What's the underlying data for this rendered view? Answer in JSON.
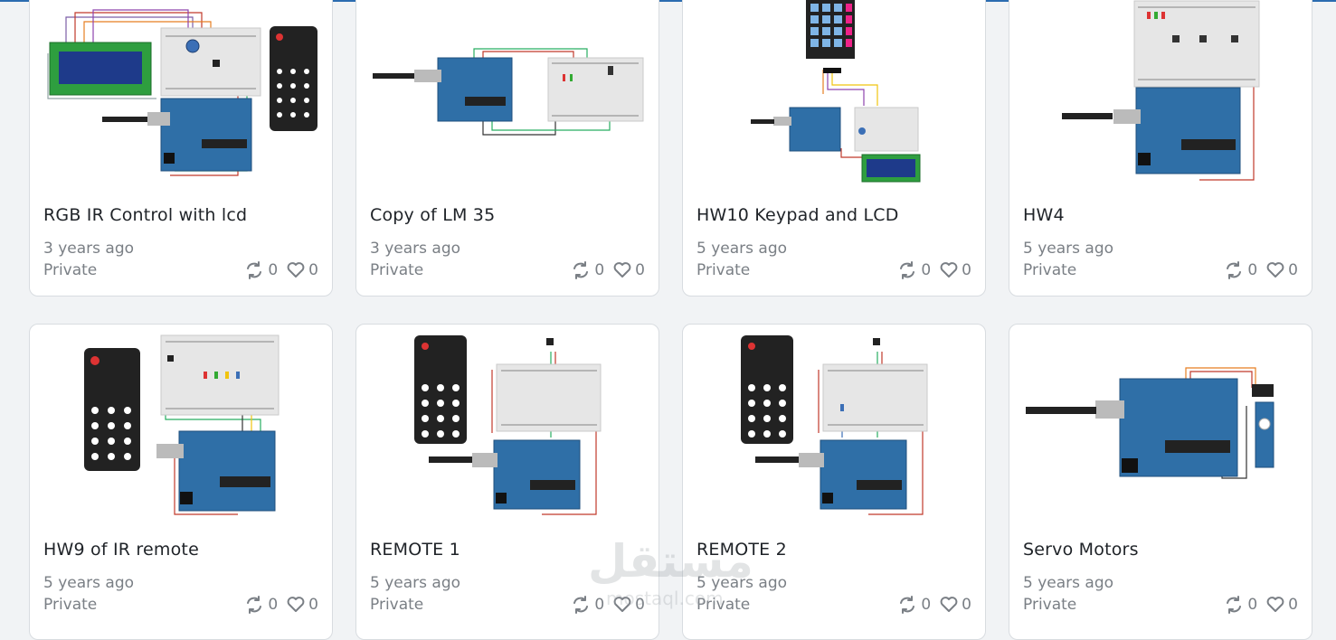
{
  "cards": [
    {
      "title": "RGB IR Control with lcd",
      "age": "3 years ago",
      "visibility": "Private",
      "remixes": "0",
      "likes": "0",
      "circuit": "rgb-ir-lcd"
    },
    {
      "title": "Copy of LM 35",
      "age": "3 years ago",
      "visibility": "Private",
      "remixes": "0",
      "likes": "0",
      "circuit": "lm35"
    },
    {
      "title": "HW10 Keypad and LCD",
      "age": "5 years ago",
      "visibility": "Private",
      "remixes": "0",
      "likes": "0",
      "circuit": "keypad-lcd"
    },
    {
      "title": "HW4",
      "age": "5 years ago",
      "visibility": "Private",
      "remixes": "0",
      "likes": "0",
      "circuit": "hw4"
    },
    {
      "title": "HW9 of IR remote",
      "age": "5 years ago",
      "visibility": "Private",
      "remixes": "0",
      "likes": "0",
      "circuit": "ir-remote-leds"
    },
    {
      "title": "REMOTE 1",
      "age": "5 years ago",
      "visibility": "Private",
      "remixes": "0",
      "likes": "0",
      "circuit": "remote1"
    },
    {
      "title": "REMOTE 2",
      "age": "5 years ago",
      "visibility": "Private",
      "remixes": "0",
      "likes": "0",
      "circuit": "remote2"
    },
    {
      "title": "Servo Motors",
      "age": "5 years ago",
      "visibility": "Private",
      "remixes": "0",
      "likes": "0",
      "circuit": "servo"
    }
  ],
  "watermark": {
    "arabic": "مستقل",
    "latin": "mostaql.com"
  },
  "colors": {
    "arduino": "#2f6fa7",
    "arduino_dark": "#1f4f7c",
    "breadboard": "#e6e6e6",
    "text": "#1f2328",
    "muted": "#7a7f85",
    "border": "#d8dce0"
  },
  "icons": {
    "remix": "remix-icon",
    "like": "heart-icon"
  }
}
